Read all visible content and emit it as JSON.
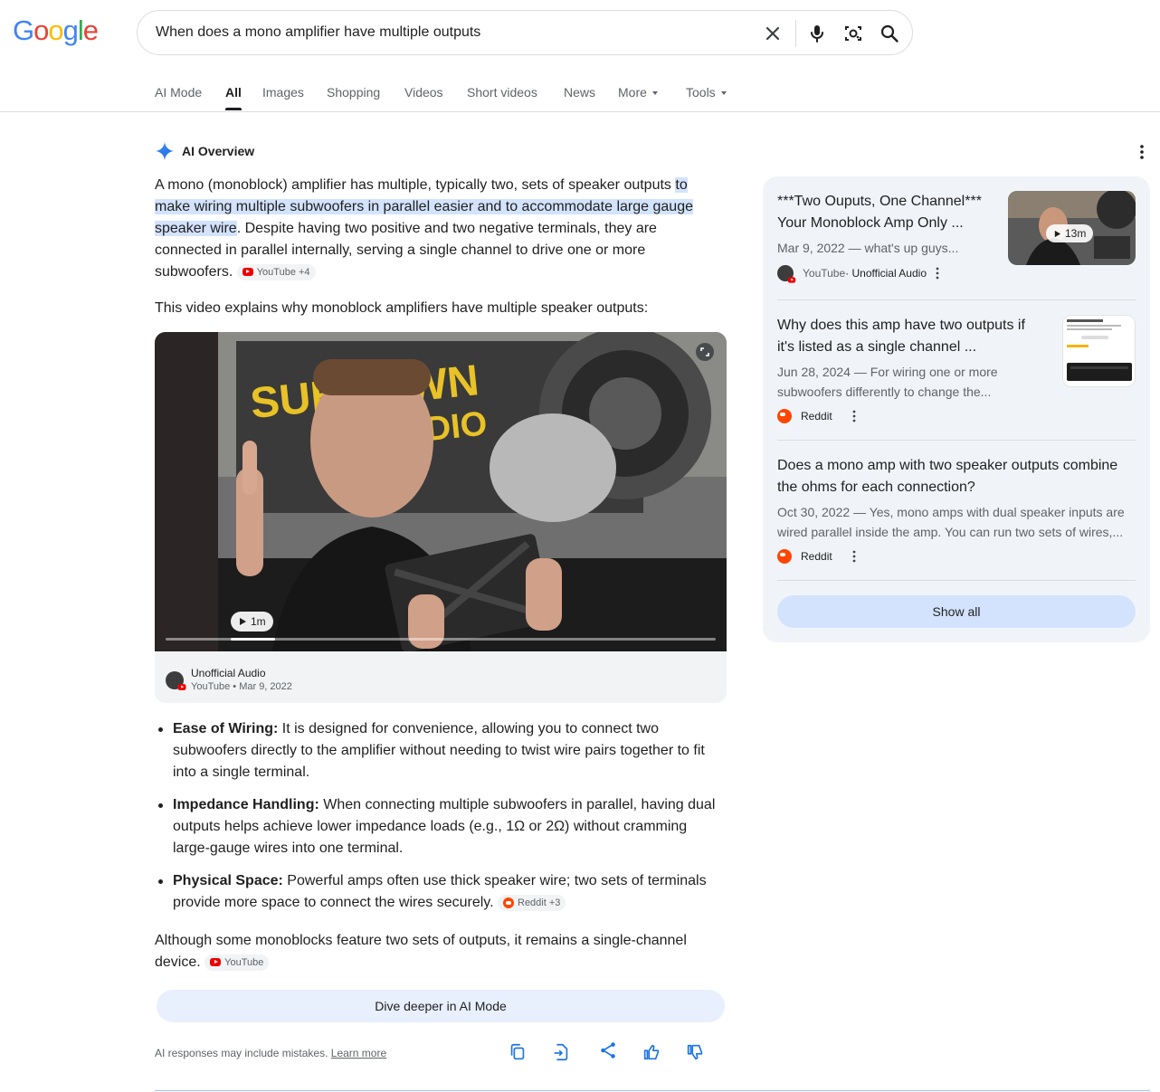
{
  "logo": "Google",
  "search": {
    "query": "When does a mono amplifier have multiple outputs"
  },
  "tabs": [
    {
      "label": "AI Mode"
    },
    {
      "label": "All"
    },
    {
      "label": "Images"
    },
    {
      "label": "Shopping"
    },
    {
      "label": "Videos"
    },
    {
      "label": "Short videos"
    },
    {
      "label": "News"
    },
    {
      "label": "More"
    },
    {
      "label": "Tools"
    }
  ],
  "aio": {
    "title": "AI Overview",
    "p1_a": "A mono (monoblock) amplifier has multiple, typically two, sets of speaker outputs ",
    "p1_hl": "to make wiring multiple subwoofers in parallel easier and to accommodate large gauge speaker wire",
    "p1_b": ". Despite having two positive and two negative terminals, they are connected in parallel internally, serving a single channel to drive one or more subwoofers.",
    "p1_chip": "YouTube +4",
    "video_intro": "This video explains why monoblock amplifiers have multiple speaker outputs:",
    "video": {
      "duration": "1m",
      "progress": 0.08,
      "channel": "Unofficial Audio",
      "source_date": "YouTube • Mar 9, 2022"
    },
    "bullets": [
      {
        "term": "Ease of Wiring:",
        "text": " It is designed for convenience, allowing you to connect two subwoofers directly to the amplifier without needing to twist wire pairs together to fit into a single terminal."
      },
      {
        "term": "Impedance Handling:",
        "text": " When connecting multiple subwoofers in parallel, having dual outputs helps achieve lower impedance loads (e.g., 1Ω or 2Ω) without cramming large-gauge wires into one terminal."
      },
      {
        "term": "Physical Space:",
        "text": " Powerful amps often use thick speaker wire; two sets of terminals provide more space to connect the wires securely.",
        "chip": "Reddit +3"
      }
    ],
    "closing": "Although some monoblocks feature two sets of outputs, it remains a single-channel device.",
    "closing_chip": "YouTube",
    "dive_deeper": "Dive deeper in AI Mode",
    "disclaimer": "AI responses may include mistakes.",
    "learn_more": "Learn more"
  },
  "sources": [
    {
      "title": "***Two Ouputs, One Channel*** Your Monoblock Amp Only ...",
      "date_snippet": "Mar 9, 2022 — what's up guys...",
      "site": "YouTube",
      "channel": " · Unofficial Audio",
      "thumb_duration": "13m"
    },
    {
      "title": "Why does this amp have two outputs if it's listed as a single channel ...",
      "date_snippet": "Jun 28, 2024 — For wiring one or more subwoofers differently to change the...",
      "site": "Reddit"
    },
    {
      "title": "Does a mono amp with two speaker outputs combine the ohms for each connection?",
      "date_snippet": "Oct 30, 2022 — Yes, mono amps with dual speaker inputs are wired parallel inside the amp. You can run two sets of wires,...",
      "site": "Reddit"
    }
  ],
  "show_all": "Show all",
  "colors": {
    "accent_blue": "#1a73e8",
    "highlight": "#d3e3fd",
    "panel_bg": "#f0f4f9"
  }
}
